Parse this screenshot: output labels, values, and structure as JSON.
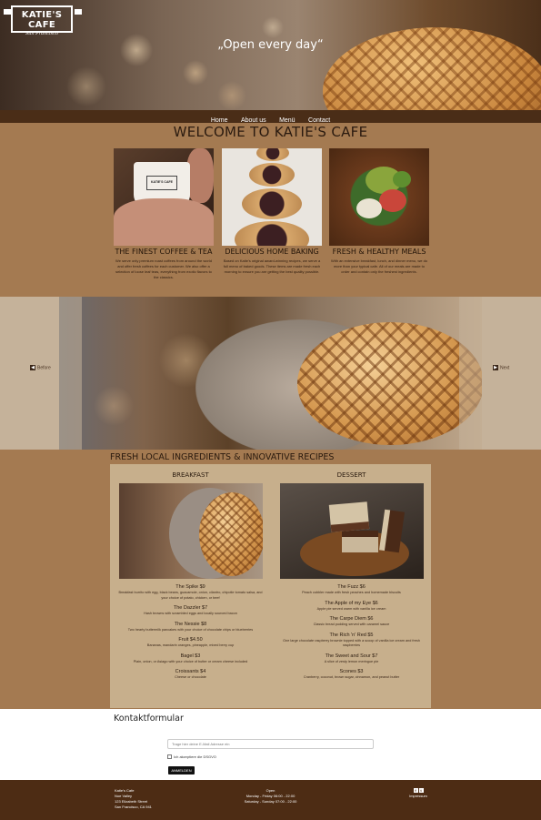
{
  "brand": {
    "name": "KATIE'S CAFE",
    "sub": "San Francisco"
  },
  "hero": {
    "tagline": "„Open every day“"
  },
  "nav": {
    "items": [
      "Home",
      "About us",
      "Menü",
      "Contact"
    ]
  },
  "welcome": {
    "title": "WELCOME TO KATIE'S CAFE",
    "features": [
      {
        "title": "THE FINEST COFFEE & TEA",
        "text": "We serve only premium roast coffees from around the world and offer fresh coffees for each customer. We also offer a selection of loose leaf teas, everything from exotic flavors to the classics."
      },
      {
        "title": "DELICIOUS HOME BAKING",
        "text": "Based on Katie's original award-winning recipes, we serve a full menu of baked goods. These items are made fresh each morning to ensure you are getting the best quality possible."
      },
      {
        "title": "FRESH & HEALTHY MEALS",
        "text": "With an extensive breakfast, lunch, and dinner menu, we do more than your typical cafe. All of our meals are made to order and contain only the freshest ingredients."
      }
    ]
  },
  "slider": {
    "prev_label": "Before",
    "next_label": "Next"
  },
  "menu": {
    "heading": "FRESH LOCAL INGREDIENTS & INNOVATIVE RECIPES",
    "breakfast": {
      "title": "BREAKFAST",
      "items": [
        {
          "name": "The Spike $9",
          "desc": "Breakfast burrito with egg, black beans, guacamole, onion, cilantro, chipotle tomato salsa, and your choice of potato, chicken, or beef"
        },
        {
          "name": "The Dazzler $7",
          "desc": "Hash browns with scrambled eggs and locally sourced bacon"
        },
        {
          "name": "The Nessie $8",
          "desc": "Two hearty buttermilk pancakes with your choice of chocolate chips or blueberries"
        },
        {
          "name": "Fruit $4.50",
          "desc": "Bananas, mandarin oranges, pineapple, mixed berry cup"
        },
        {
          "name": "Bagel $3",
          "desc": "Plain, onion, or Asiago with your choice of butter or cream cheese included"
        },
        {
          "name": "Croissants $4",
          "desc": "Cheese or chocolate"
        }
      ]
    },
    "dessert": {
      "title": "DESSERT",
      "items": [
        {
          "name": "The Fuzz $6",
          "desc": "Peach cobbler made with fresh peaches and homemade biscuits"
        },
        {
          "name": "The Apple of my Eye $6",
          "desc": "Apple pie served warm with vanilla ice cream"
        },
        {
          "name": "The Carpe Diem $6",
          "desc": "Classic bread pudding served with caramel sauce"
        },
        {
          "name": "The Rich 'n' Red $5",
          "desc": "One large chocolate raspberry brownie topped with a scoop of vanilla ice cream and fresh raspberries"
        },
        {
          "name": "The Sweet and Sour $7",
          "desc": "A slice of zesty lemon meringue pie"
        },
        {
          "name": "Scones $3",
          "desc": "Cranberry, coconut, brown sugar, cinnamon, and peanut butter"
        }
      ]
    }
  },
  "contact": {
    "title": "Kontaktformular",
    "email_placeholder": "Trage hier deine E-Mail Adresse ein",
    "consent_label": "Ich akzeptiere die DSGVO",
    "submit_label": "ANMELDEN"
  },
  "footer": {
    "address": [
      "Katie's Cafe",
      "Noe Valley",
      "123 Elizabeth Street",
      "San Francisco, CA 941"
    ],
    "hours_title": "Open",
    "hours": [
      "Monday - Friday 06:00 - 22:00",
      "Saturday - Sunday 07:00 - 22:00"
    ],
    "impressum": "Impressum",
    "social": [
      "facebook-icon",
      "twitter-icon"
    ]
  }
}
